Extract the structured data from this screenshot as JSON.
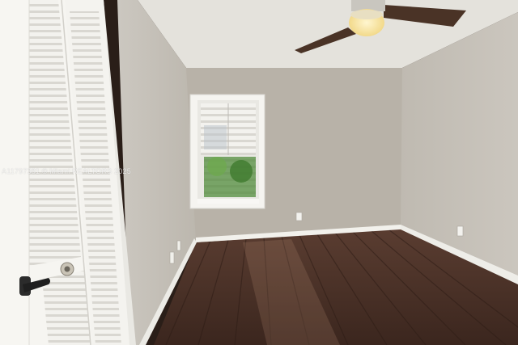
{
  "photo": {
    "watermark": "A11797381 © Miami REALTORS 2025"
  },
  "colors": {
    "ceiling": "#e6e4de",
    "back_wall": "#b9b3a9",
    "right_wall": "#c2bdb4",
    "left_wall": "#c6c2ba",
    "floor": "#4a3128",
    "baseboard": "#f2f1ec",
    "door": "#f4f3ef",
    "fan_blade": "#4a3326"
  },
  "icons": [
    "ceiling-fan-icon",
    "window-shutter-icon",
    "outlet-icon",
    "door-knob-icon",
    "lock-icon"
  ]
}
